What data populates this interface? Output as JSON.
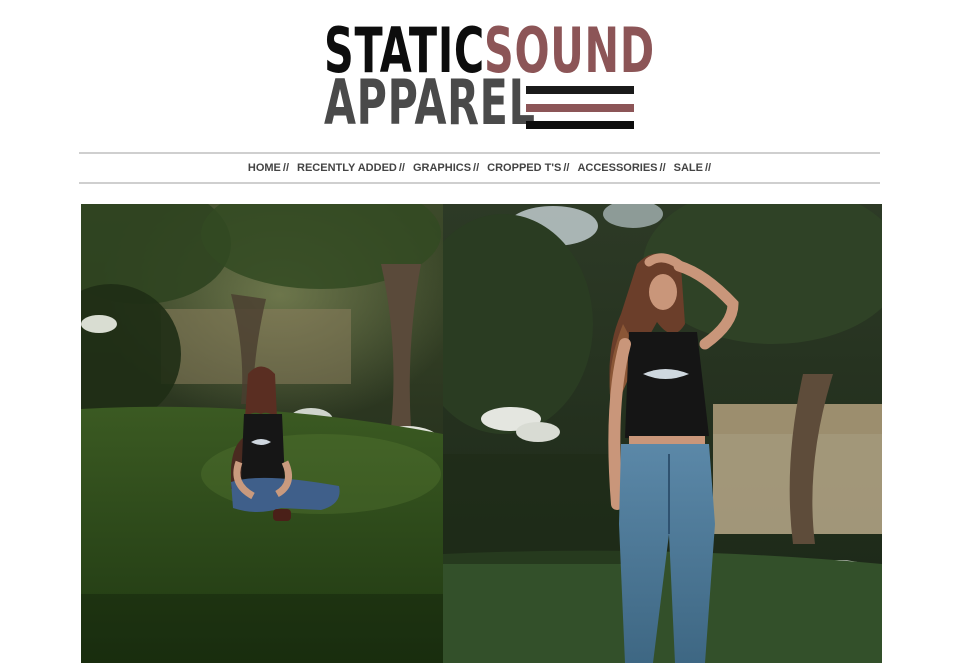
{
  "logo": {
    "line1_word1": "STATIC",
    "line1_word2": "SOUND",
    "line2": "APPAREL"
  },
  "nav": {
    "items": [
      {
        "label": "HOME"
      },
      {
        "label": "RECENTLY ADDED"
      },
      {
        "label": "GRAPHICS"
      },
      {
        "label": "CROPPED T'S"
      },
      {
        "label": "ACCESSORIES"
      },
      {
        "label": "SALE"
      }
    ],
    "separator": "//"
  },
  "colors": {
    "logo_black": "#0d0d0d",
    "logo_accent": "#8c5557",
    "logo_gray": "#4a4a4a",
    "nav_text": "#444444",
    "divider": "#cfcfcf"
  }
}
